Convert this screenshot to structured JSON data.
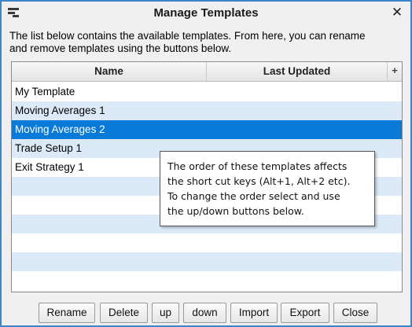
{
  "window": {
    "title": "Manage Templates",
    "close_symbol": "✕"
  },
  "description": {
    "line1": "The list below contains the available templates.  From here, you can rename",
    "line2": "and remove templates using the buttons below."
  },
  "table": {
    "columns": [
      "Name",
      "Last Updated"
    ],
    "add_column_symbol": "+",
    "rows": [
      {
        "name": "My Template",
        "updated": ""
      },
      {
        "name": "Moving Averages 1",
        "updated": ""
      },
      {
        "name": "Moving Averages 2",
        "updated": ""
      },
      {
        "name": "Trade Setup 1",
        "updated": ""
      },
      {
        "name": "Exit Strategy 1",
        "updated": ""
      },
      {
        "name": "",
        "updated": ""
      },
      {
        "name": "",
        "updated": ""
      },
      {
        "name": "",
        "updated": ""
      },
      {
        "name": "",
        "updated": ""
      },
      {
        "name": "",
        "updated": ""
      },
      {
        "name": "",
        "updated": ""
      }
    ],
    "selected_row": 2
  },
  "tooltip": {
    "lines": [
      "The order of these templates affects",
      "the short cut keys (Alt+1, Alt+2 etc).",
      "To  change the order select and use",
      "the up/down buttons below."
    ]
  },
  "buttons": {
    "rename": "Rename",
    "delete": "Delete",
    "up": "up",
    "down": "down",
    "import": "Import",
    "export": "Export",
    "close": "Close"
  },
  "colors": {
    "window_border": "#3a86c9",
    "selected_row": "#0a7ad9",
    "alt_row": "#dceaf8"
  },
  "icons": {
    "app": "window-menu-icon",
    "close": "close-icon"
  }
}
